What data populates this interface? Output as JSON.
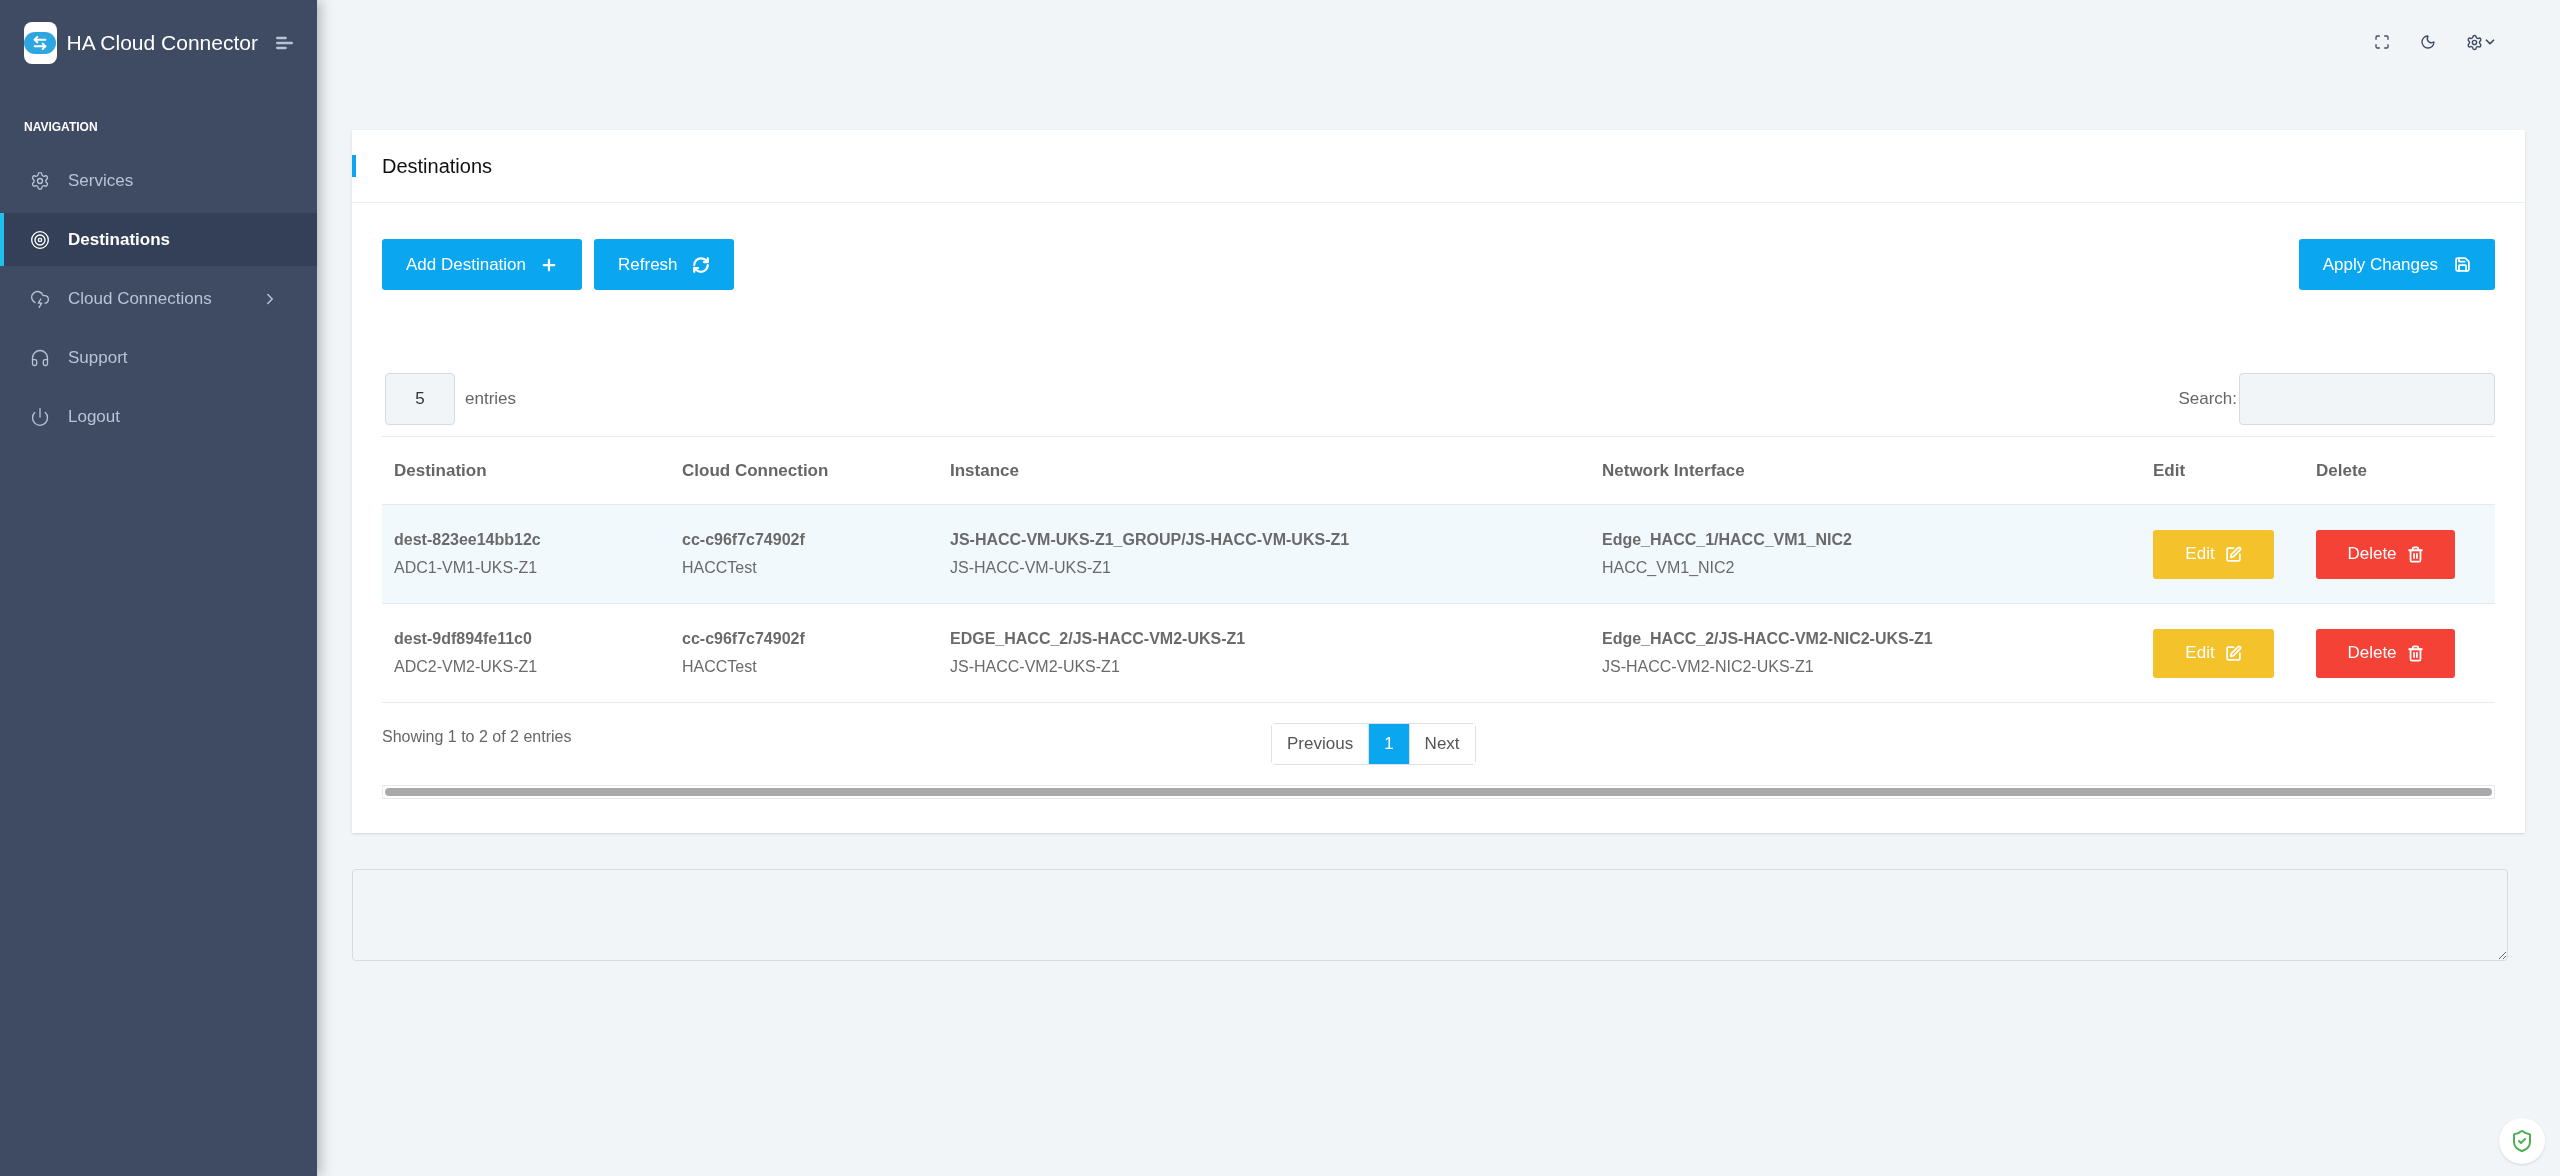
{
  "app": {
    "title": "HA Cloud Connector"
  },
  "sidebar": {
    "section_label": "NAVIGATION",
    "items": [
      {
        "label": "Services",
        "selected": false,
        "has_submenu": false
      },
      {
        "label": "Destinations",
        "selected": true,
        "has_submenu": false
      },
      {
        "label": "Cloud Connections",
        "selected": false,
        "has_submenu": true
      },
      {
        "label": "Support",
        "selected": false,
        "has_submenu": false
      },
      {
        "label": "Logout",
        "selected": false,
        "has_submenu": false
      }
    ]
  },
  "card": {
    "title": "Destinations",
    "actions": [
      {
        "label": "Add Destination"
      },
      {
        "label": "Refresh"
      }
    ],
    "apply_button": {
      "label": "Apply Changes"
    },
    "page_length": {
      "value": "5",
      "label": "entries"
    },
    "search": {
      "label": "Search:"
    },
    "table": {
      "columns": [
        "Destination",
        "Cloud Connection",
        "Instance",
        "Network Interface",
        "Edit",
        "Delete"
      ],
      "rows": [
        {
          "highlighted": true,
          "destination": [
            "dest-823ee14bb12c",
            "ADC1-VM1-UKS-Z1"
          ],
          "cloud_connection": [
            "cc-c96f7c74902f",
            "HACCTest"
          ],
          "instance": [
            "JS-HACC-VM-UKS-Z1_GROUP/JS-HACC-VM-UKS-Z1",
            "JS-HACC-VM-UKS-Z1"
          ],
          "network_interface": [
            "Edge_HACC_1/HACC_VM1_NIC2",
            "HACC_VM1_NIC2"
          ],
          "edit": "Edit",
          "delete": "Delete"
        },
        {
          "highlighted": false,
          "destination": [
            "dest-9df894fe11c0",
            "ADC2-VM2-UKS-Z1"
          ],
          "cloud_connection": [
            "cc-c96f7c74902f",
            "HACCTest"
          ],
          "instance": [
            "EDGE_HACC_2/JS-HACC-VM2-UKS-Z1",
            "JS-HACC-VM2-UKS-Z1"
          ],
          "network_interface": [
            "Edge_HACC_2/JS-HACC-VM2-NIC2-UKS-Z1",
            "JS-HACC-VM2-NIC2-UKS-Z1"
          ],
          "edit": "Edit",
          "delete": "Delete"
        }
      ]
    },
    "info": "Showing 1 to 2 of 2 entries",
    "pagination": [
      {
        "label": "Previous",
        "selected": false
      },
      {
        "label": "1",
        "selected": true
      },
      {
        "label": "Next",
        "selected": false
      }
    ]
  }
}
